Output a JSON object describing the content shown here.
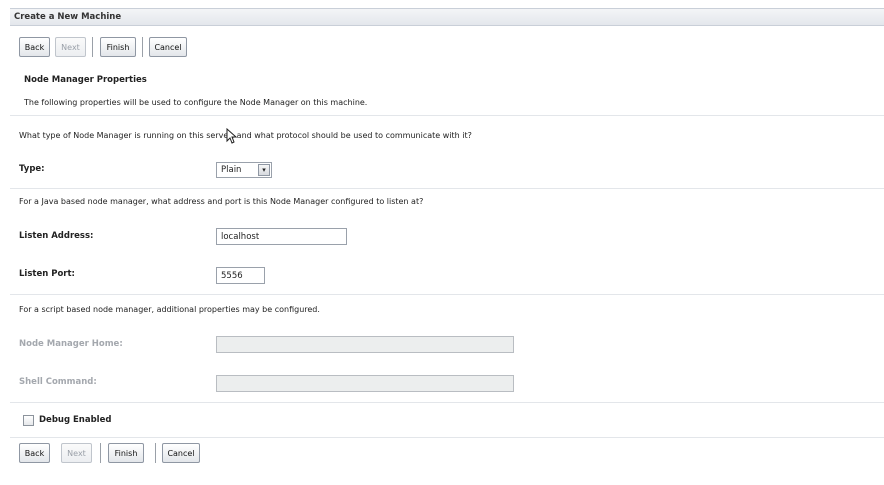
{
  "window": {
    "title": "Create a New Machine"
  },
  "buttons": {
    "back": "Back",
    "next": "Next",
    "finish": "Finish",
    "cancel": "Cancel"
  },
  "section": {
    "title": "Node Manager Properties",
    "description": "The following properties will be used to configure the Node Manager on this machine."
  },
  "type_question": "What type of Node Manager is running on this server, and what protocol should be used to communicate with it?",
  "type": {
    "label": "Type:",
    "value": "Plain",
    "arrow_icon": "chevron-down-icon"
  },
  "java_question": "For a Java based node manager, what address and port is this Node Manager configured to listen at?",
  "listen_address": {
    "label": "Listen Address:",
    "value": "localhost"
  },
  "listen_port": {
    "label": "Listen Port:",
    "value": "5556"
  },
  "script_note": "For a script based node manager, additional properties may be configured.",
  "node_manager_home": {
    "label": "Node Manager Home:",
    "value": ""
  },
  "shell_command": {
    "label": "Shell Command:",
    "value": ""
  },
  "debug": {
    "label": "Debug Enabled",
    "checked": false
  }
}
